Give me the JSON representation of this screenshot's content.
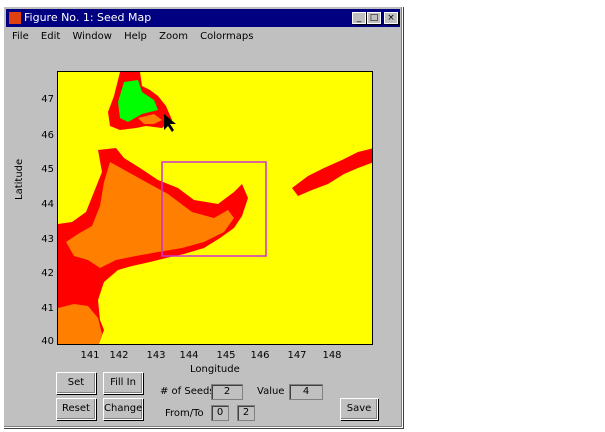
{
  "window": {
    "title": "Figure No. 1: Seed Map",
    "controls": [
      "_",
      "□",
      "×"
    ]
  },
  "menu": [
    "File",
    "Edit",
    "Window",
    "Help",
    "Zoom",
    "Colormaps"
  ],
  "axes": {
    "xlabel": "Longitude",
    "ylabel": "Latitude",
    "xticks": [
      "141",
      "142",
      "143",
      "144",
      "145",
      "146",
      "147",
      "148"
    ],
    "yticks": [
      "47",
      "46",
      "45",
      "44",
      "43",
      "42",
      "41",
      "40"
    ]
  },
  "colors": {
    "land": "#ffff00",
    "coast": "#ff0000",
    "seed": "#ff8000",
    "green": "#00ff00",
    "selection": "#cc33cc"
  },
  "controls": {
    "set_label": "Set",
    "fill_label": "Fill In",
    "reset_label": "Reset",
    "change_label": "Change",
    "seeds_label": "# of Seeds",
    "seeds_value": "2",
    "value_label": "Value",
    "value_value": "4",
    "from_to_label": "From/To",
    "from_value": "0",
    "to_value": "2",
    "save_label": "Save"
  }
}
